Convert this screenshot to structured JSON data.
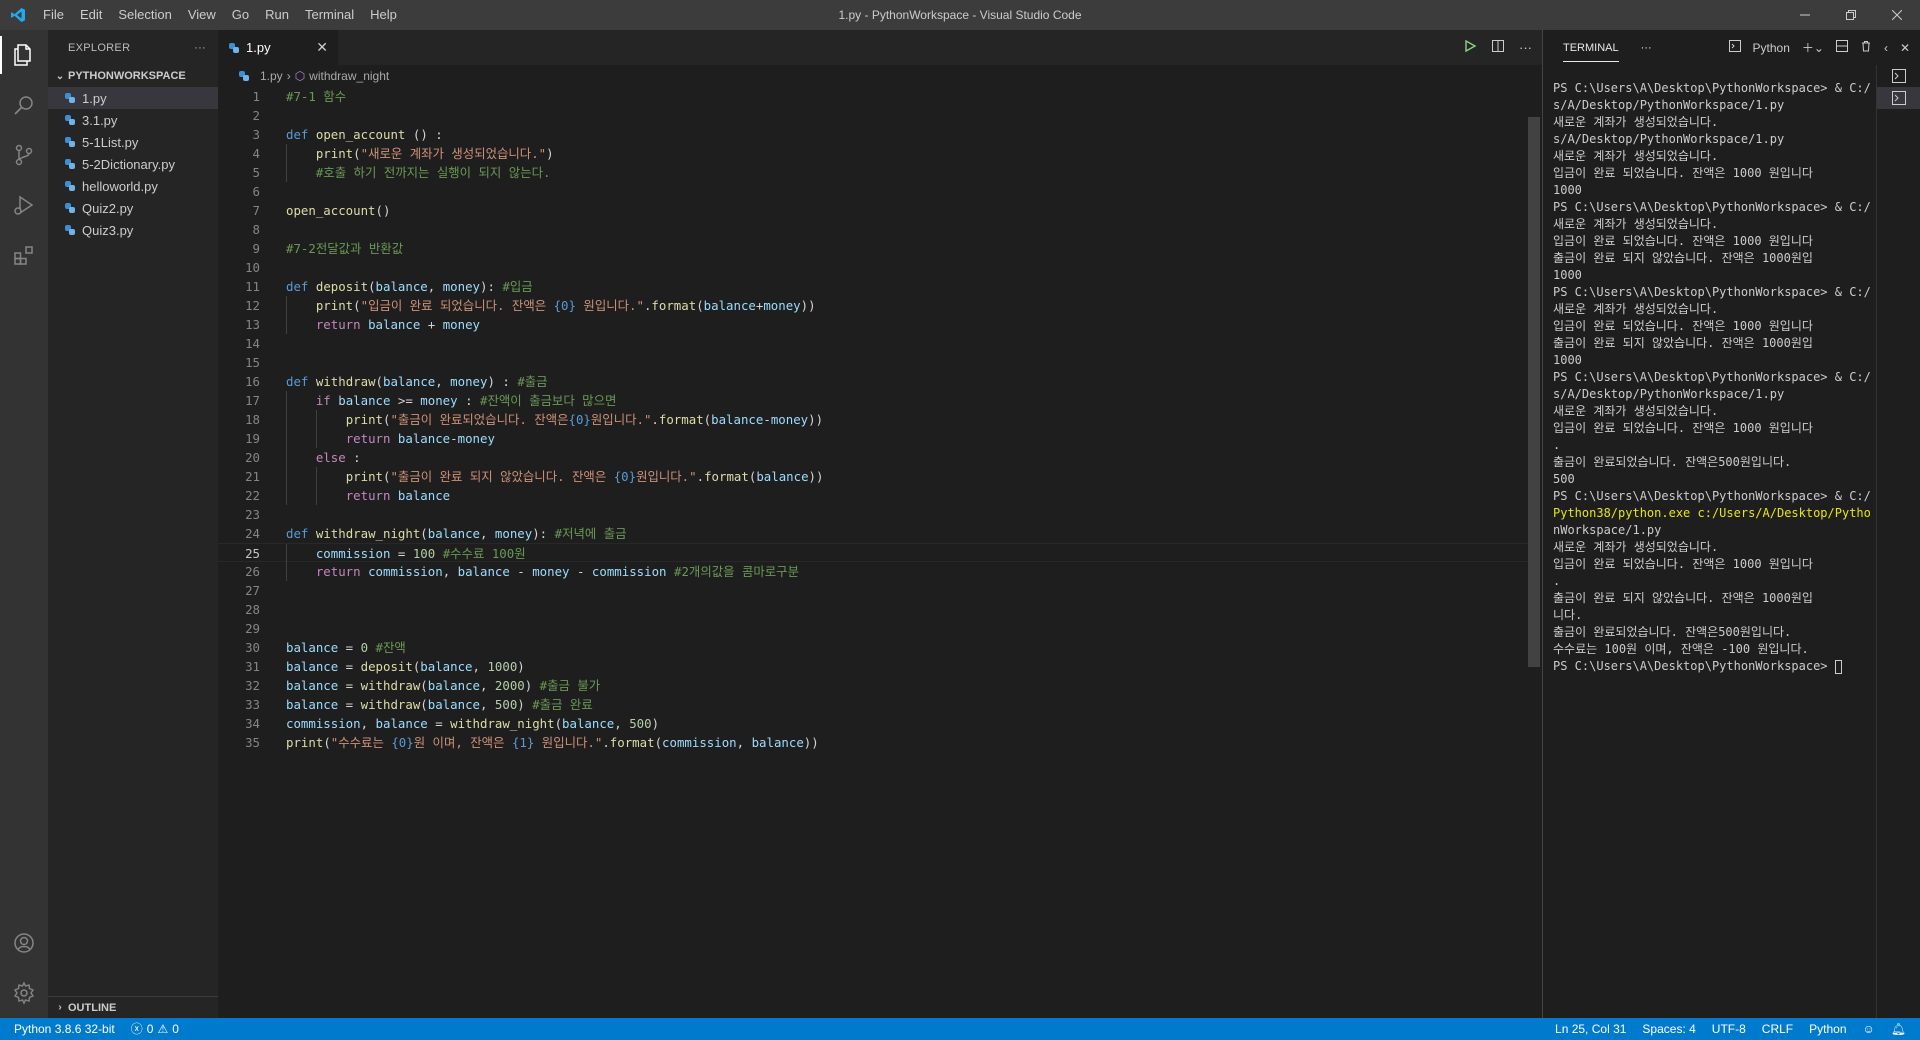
{
  "titlebar": {
    "title": "1.py - PythonWorkspace - Visual Studio Code",
    "menu": [
      "File",
      "Edit",
      "Selection",
      "View",
      "Go",
      "Run",
      "Terminal",
      "Help"
    ]
  },
  "sidebar": {
    "header": "EXPLORER",
    "workspace": "PYTHONWORKSPACE",
    "files": [
      "1.py",
      "3.1.py",
      "5-1List.py",
      "5-2Dictionary.py",
      "helloworld.py",
      "Quiz2.py",
      "Quiz3.py"
    ],
    "outline": "OUTLINE"
  },
  "editor": {
    "tab": "1.py",
    "breadcrumb_file": "1.py",
    "breadcrumb_symbol": "withdraw_night",
    "current_line": 25
  },
  "terminal": {
    "tab": "TERMINAL",
    "shell": "Python",
    "lines": [
      "PS C:\\Users\\A\\Desktop\\PythonWorkspace> & C:/",
      "s/A/Desktop/PythonWorkspace/1.py",
      "새로운 계좌가 생성되었습니다.",
      "s/A/Desktop/PythonWorkspace/1.py",
      "새로운 계좌가 생성되었습니다.",
      "입금이 완료 되었습니다. 잔액은 1000 원입니다",
      "1000",
      "PS C:\\Users\\A\\Desktop\\PythonWorkspace> & C:/",
      "새로운 계좌가 생성되었습니다.",
      "입금이 완료 되었습니다. 잔액은 1000 원입니다",
      "출금이 완료 되지 않았습니다. 잔액은 1000원입",
      "1000",
      "PS C:\\Users\\A\\Desktop\\PythonWorkspace> & C:/",
      "새로운 계좌가 생성되었습니다.",
      "입금이 완료 되었습니다. 잔액은 1000 원입니다",
      "출금이 완료 되지 않았습니다. 잔액은 1000원입",
      "1000",
      "PS C:\\Users\\A\\Desktop\\PythonWorkspace> & C:/",
      "s/A/Desktop/PythonWorkspace/1.py",
      "새로운 계좌가 생성되었습니다.",
      "입금이 완료 되었습니다. 잔액은 1000 원입니다",
      ".",
      "출금이 완료되었습니다. 잔액은500원입니다.",
      "500",
      "PS C:\\Users\\A\\Desktop\\PythonWorkspace> & C:/",
      "Python38/python.exe c:/Users/A/Desktop/Pytho",
      "nWorkspace/1.py",
      "새로운 계좌가 생성되었습니다.",
      "입금이 완료 되었습니다. 잔액은 1000 원입니다",
      ".",
      "출금이 완료 되지 않았습니다. 잔액은 1000원입",
      "니다.",
      "출금이 완료되었습니다. 잔액은500원입니다.",
      "수수료는 100원 이며, 잔액은 -100 원입니다.",
      "PS C:\\Users\\A\\Desktop\\PythonWorkspace> "
    ]
  },
  "statusbar": {
    "python": "Python 3.8.6 32-bit",
    "errors": "0",
    "warnings": "0",
    "position": "Ln 25, Col 31",
    "spaces": "Spaces: 4",
    "encoding": "UTF-8",
    "eol": "CRLF",
    "language": "Python"
  }
}
